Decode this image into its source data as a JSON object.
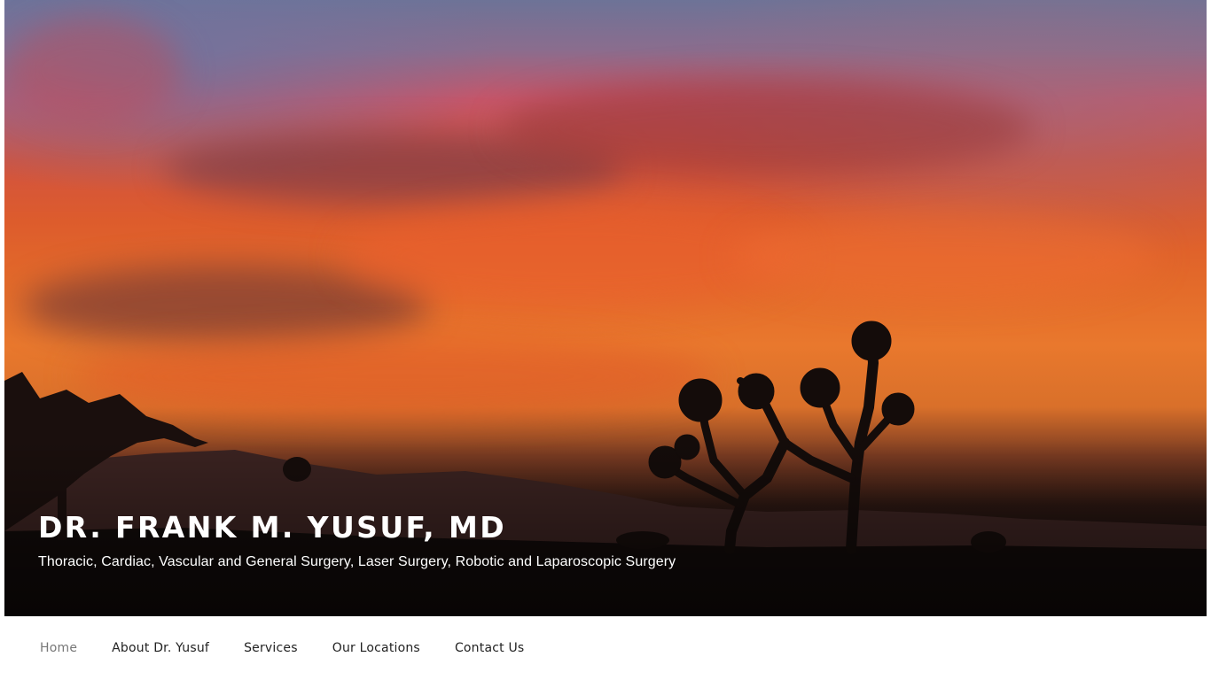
{
  "header": {
    "title": "DR. FRANK M. YUSUF, MD",
    "tagline": "Thoracic, Cardiac, Vascular and General Surgery, Laser Surgery, Robotic and Laparoscopic Surgery"
  },
  "nav": {
    "items": [
      {
        "label": "Home",
        "active": true
      },
      {
        "label": "About Dr. Yusuf",
        "active": false
      },
      {
        "label": "Services",
        "active": false
      },
      {
        "label": "Our Locations",
        "active": false
      },
      {
        "label": "Contact Us",
        "active": false
      }
    ]
  },
  "colors": {
    "nav_active": "#777777",
    "nav_text": "#222222",
    "title_text": "#ffffff"
  }
}
